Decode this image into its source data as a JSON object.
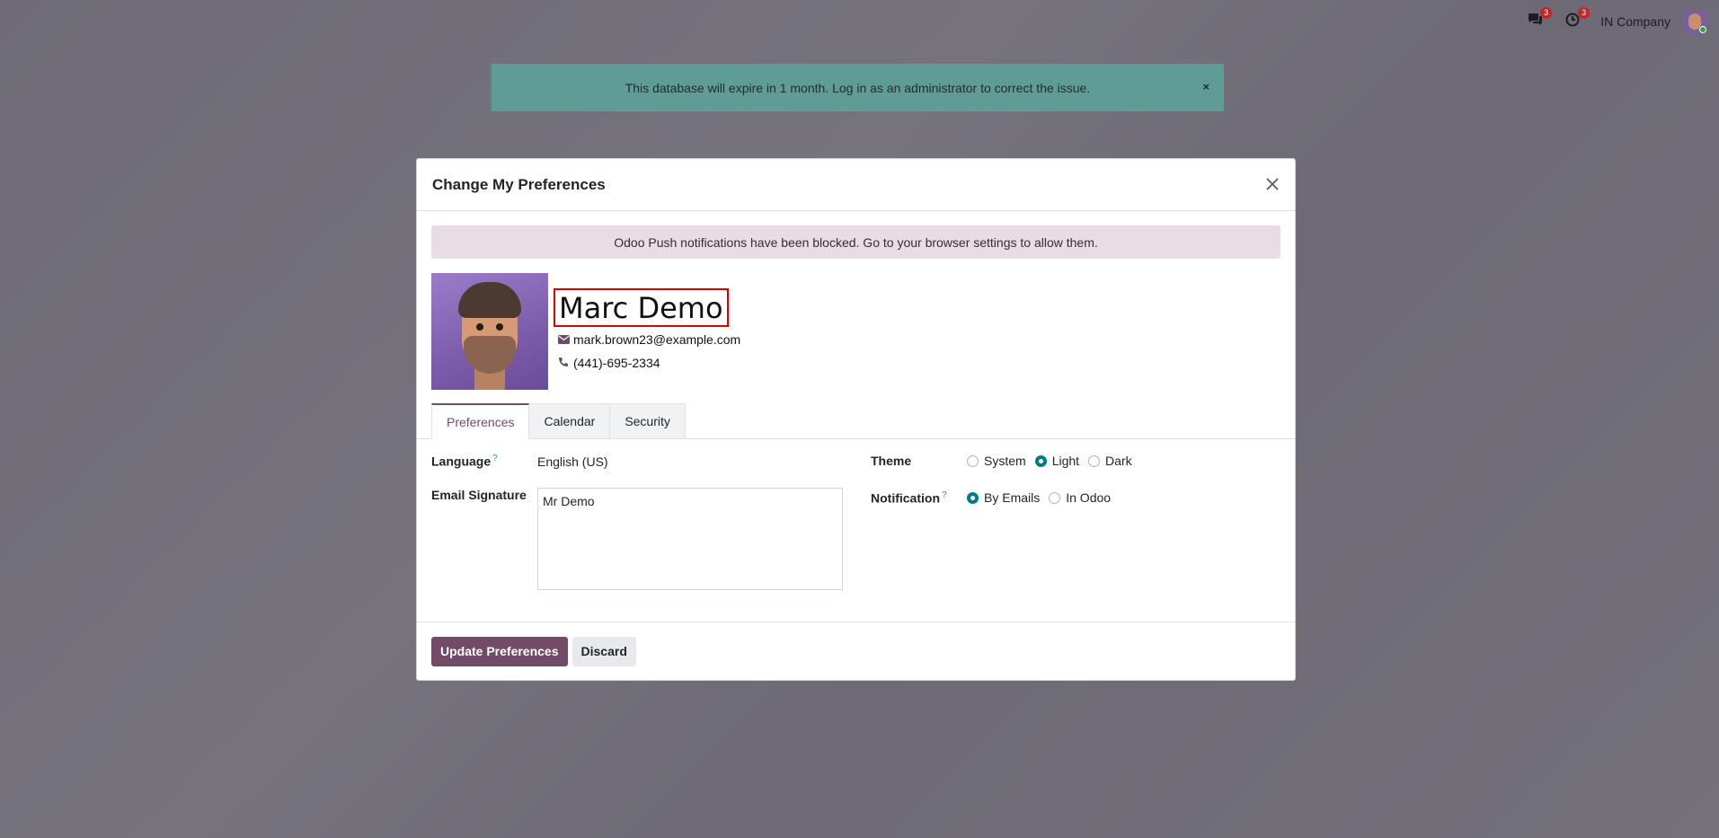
{
  "topbar": {
    "messages_badge": "3",
    "activities_badge": "3",
    "company": "IN Company",
    "icons": {
      "messages": "chat-icon",
      "activities": "clock-icon"
    }
  },
  "expire_banner": {
    "text": "This database will expire in 1 month. Log in as an administrator to correct the issue.",
    "close": "×"
  },
  "modal": {
    "title": "Change My Preferences",
    "close": "×",
    "push_alert": "Odoo Push notifications have been blocked. Go to your browser settings to allow them.",
    "user": {
      "name": "Marc Demo",
      "email": "mark.brown23@example.com",
      "phone": "(441)-695-2334"
    },
    "tabs": [
      "Preferences",
      "Calendar",
      "Security"
    ],
    "active_tab": "Preferences",
    "form": {
      "language_label": "Language",
      "language_value": "English (US)",
      "signature_label": "Email Signature",
      "signature_value": "Mr Demo",
      "theme_label": "Theme",
      "theme_options": [
        "System",
        "Light",
        "Dark"
      ],
      "theme_selected": "Light",
      "notification_label": "Notification",
      "notification_options": [
        "By Emails",
        "In Odoo"
      ],
      "notification_selected": "By Emails",
      "help_mark": "?"
    },
    "footer": {
      "primary": "Update Preferences",
      "secondary": "Discard"
    }
  },
  "colors": {
    "brand": "#714b67",
    "radio_accent": "#017e84",
    "highlight_border": "#e00000"
  }
}
